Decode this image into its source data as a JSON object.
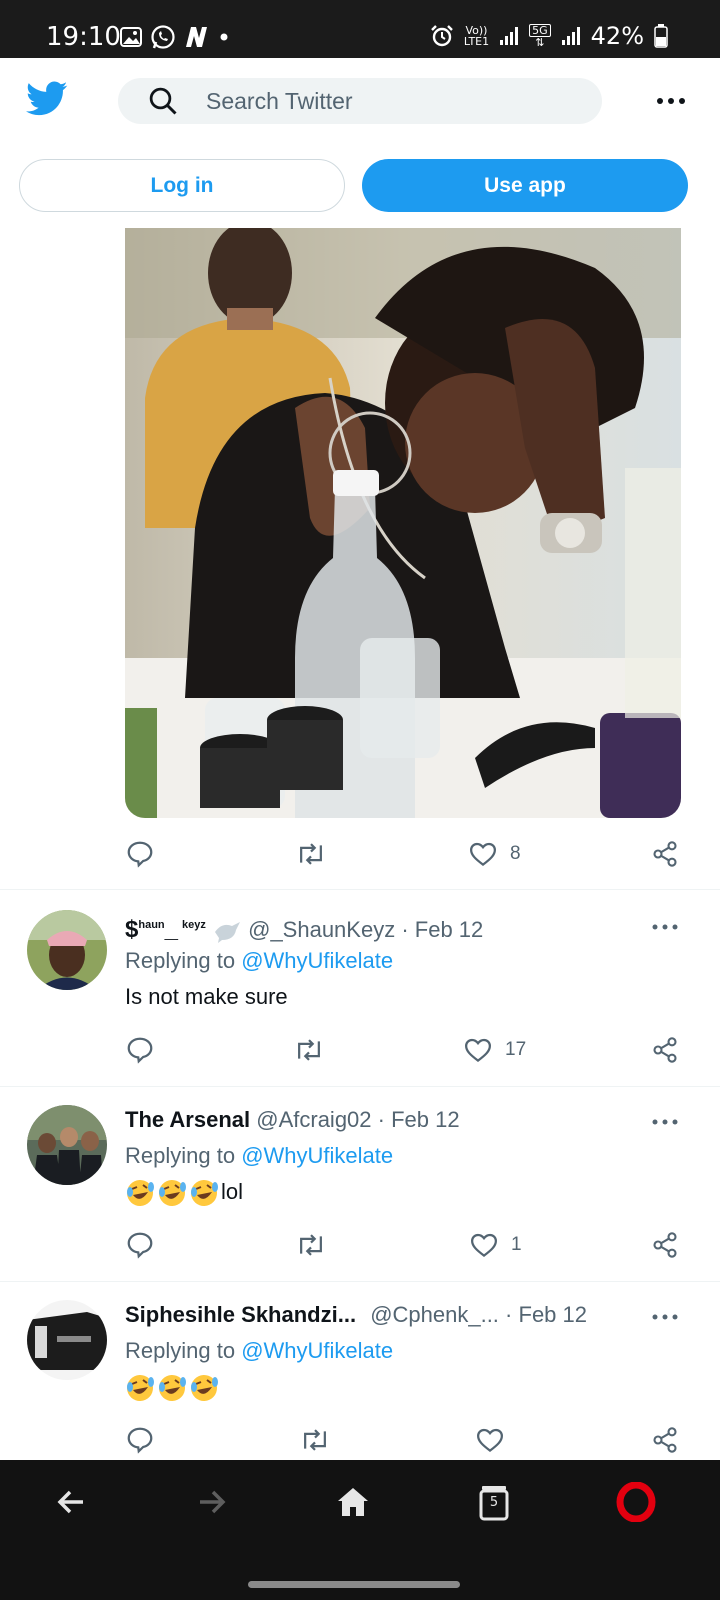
{
  "status_bar": {
    "time": "19:10",
    "volte_top": "Vo))",
    "volte_bottom": "LTE1",
    "net_top": "5G",
    "battery": "42%"
  },
  "header": {
    "search_placeholder": "Search Twitter",
    "login_label": "Log in",
    "useapp_label": "Use app"
  },
  "main_tweet_actions": {
    "likes": "8"
  },
  "replies": [
    {
      "name_prefix": "$",
      "name_sup1": "haun",
      "name_sup2": "keyz",
      "name_mid": "_",
      "handle": "@_ShaunKeyz",
      "date": "Feb 12",
      "replying_prefix": "Replying to",
      "replying_handle": "@WhyUfikelate",
      "text": "Is not make sure",
      "likes": "17"
    },
    {
      "name": "The Arsenal",
      "handle": "@Afcraig02",
      "date": "Feb 12",
      "replying_prefix": "Replying to",
      "replying_handle": "@WhyUfikelate",
      "text_suffix": "lol",
      "likes": "1"
    },
    {
      "name": "Siphesihle Skhandzi...",
      "handle": "@Cphenk_...",
      "date": "Feb 12",
      "replying_prefix": "Replying to",
      "replying_handle": "@WhyUfikelate",
      "likes": ""
    }
  ],
  "browser_nav": {
    "tab_count": "5"
  },
  "colors": {
    "brand": "#1d9bf0",
    "text_primary": "#0f1419",
    "text_secondary": "#536471",
    "opera_red": "#e3000f"
  },
  "icons": [
    "twitter-bird-icon",
    "search-icon",
    "more-icon",
    "reply-icon",
    "retweet-icon",
    "like-icon",
    "share-icon",
    "back-icon",
    "forward-icon",
    "home-icon",
    "tabs-icon",
    "opera-icon"
  ]
}
